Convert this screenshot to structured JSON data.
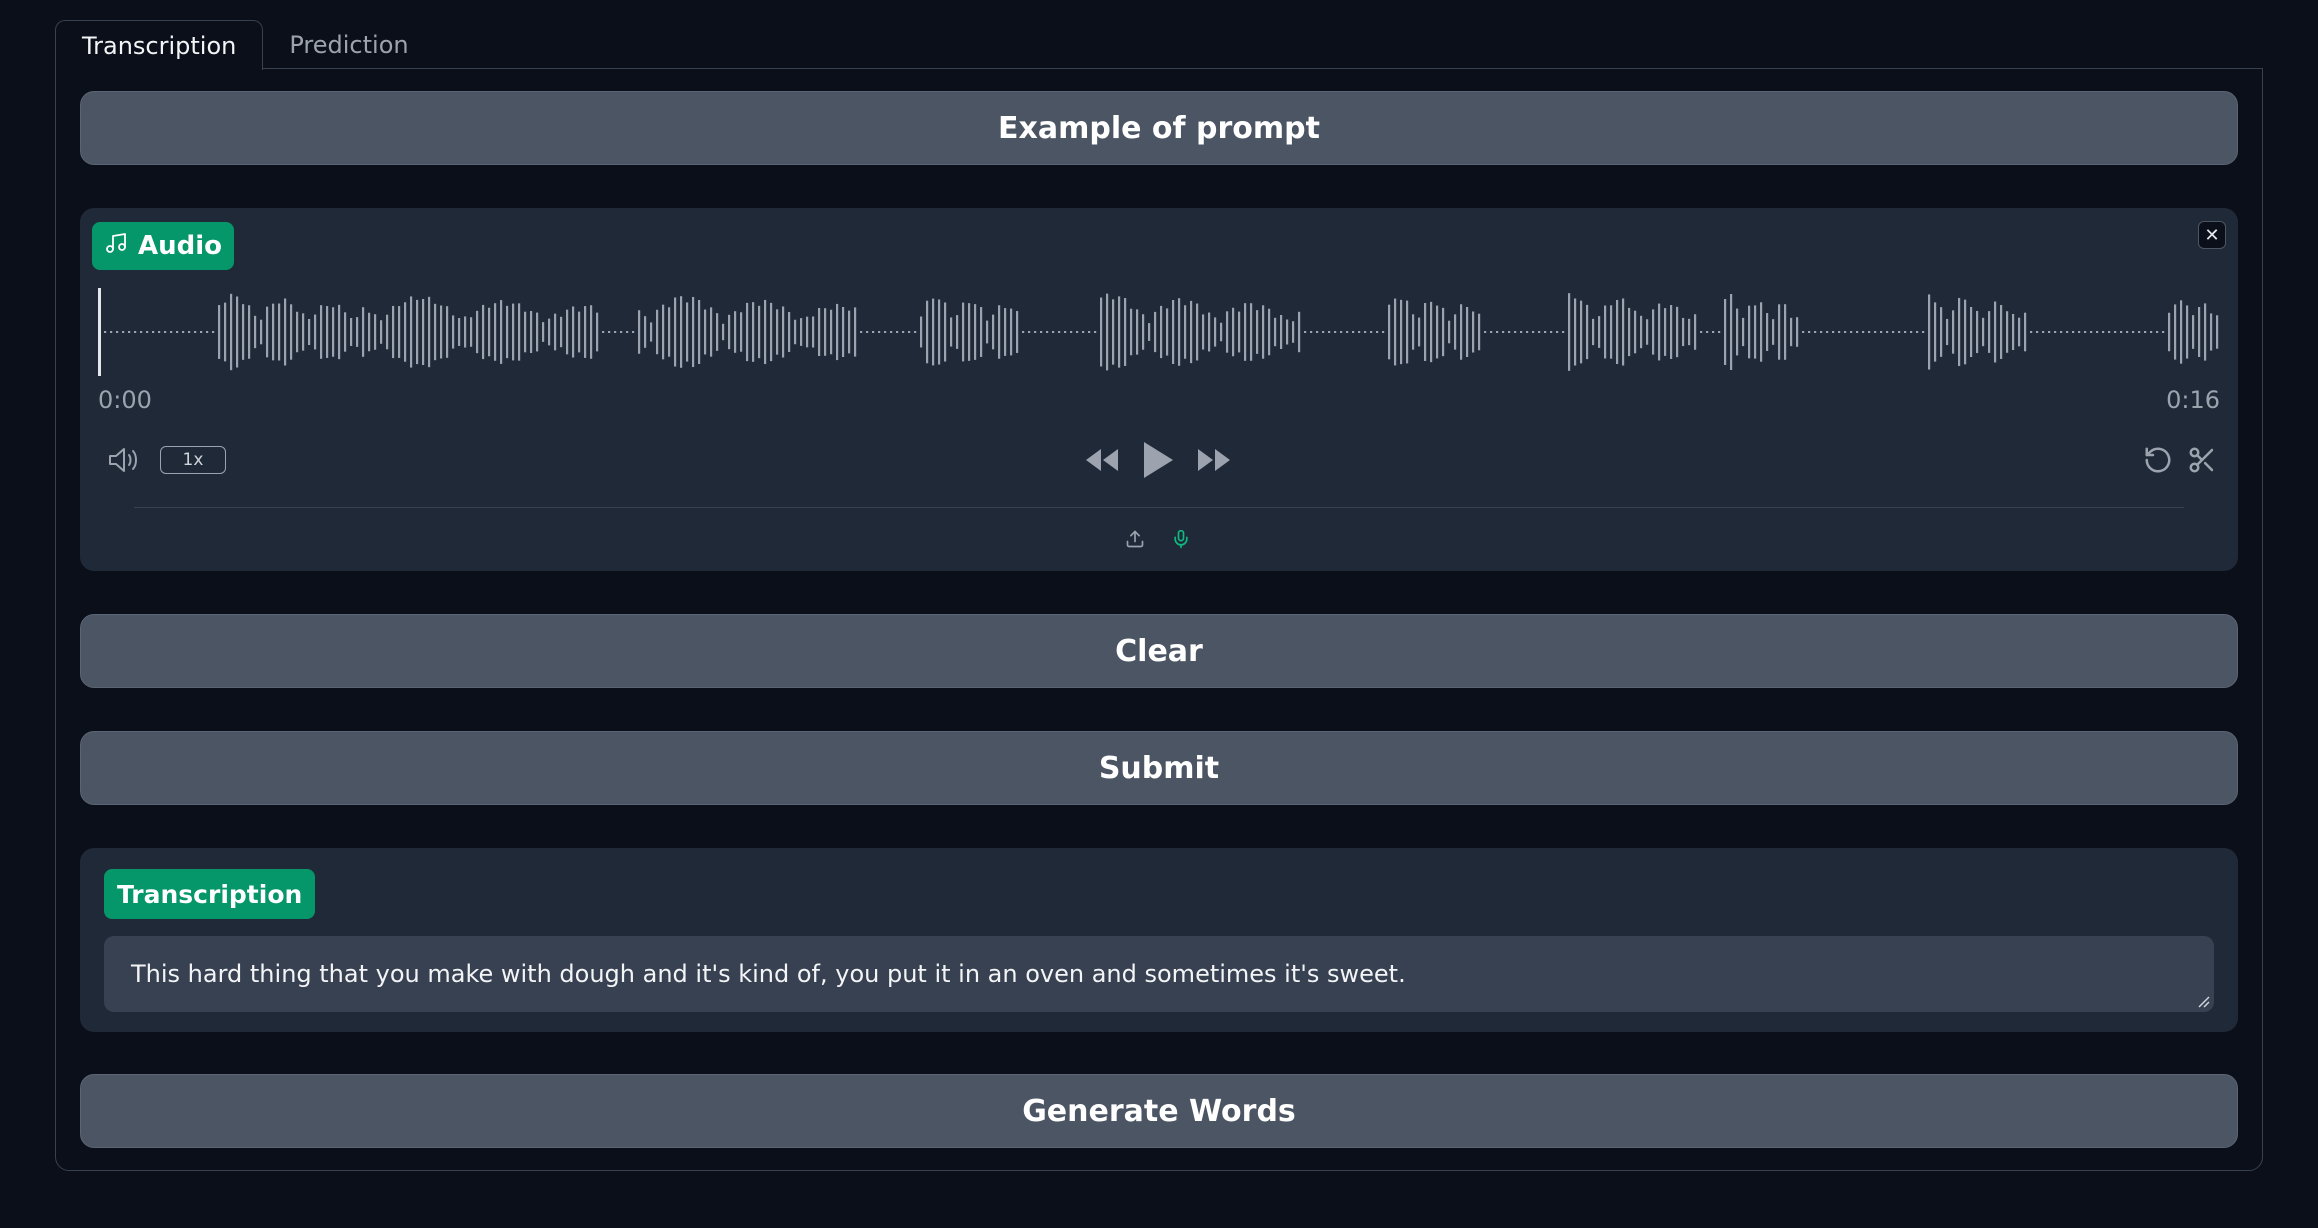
{
  "tabs": [
    {
      "label": "Transcription",
      "active": true
    },
    {
      "label": "Prediction",
      "active": false
    }
  ],
  "example_button": {
    "label": "Example of prompt"
  },
  "audio": {
    "label": "Audio",
    "icon": "music-note-icon",
    "time_start": "0:00",
    "time_end": "0:16",
    "speed": "1x",
    "icons": {
      "volume": "volume-icon",
      "rewind": "rewind-icon",
      "play": "play-icon",
      "fast_forward": "fast-forward-icon",
      "reset": "undo-icon",
      "trim": "scissors-icon",
      "upload": "upload-icon",
      "microphone": "microphone-icon",
      "close": "close-icon"
    }
  },
  "clear_button": {
    "label": "Clear"
  },
  "submit_button": {
    "label": "Submit"
  },
  "transcription": {
    "label": "Transcription",
    "text": "This hard thing that you make with dough and it's kind of, you put it in an oven and sometimes it's sweet."
  },
  "generate_button": {
    "label": "Generate Words"
  },
  "colors": {
    "background": "#0b0f19",
    "block": "#1f2937",
    "button": "#4b5563",
    "accent": "#059669",
    "mic_accent": "#10b981"
  }
}
